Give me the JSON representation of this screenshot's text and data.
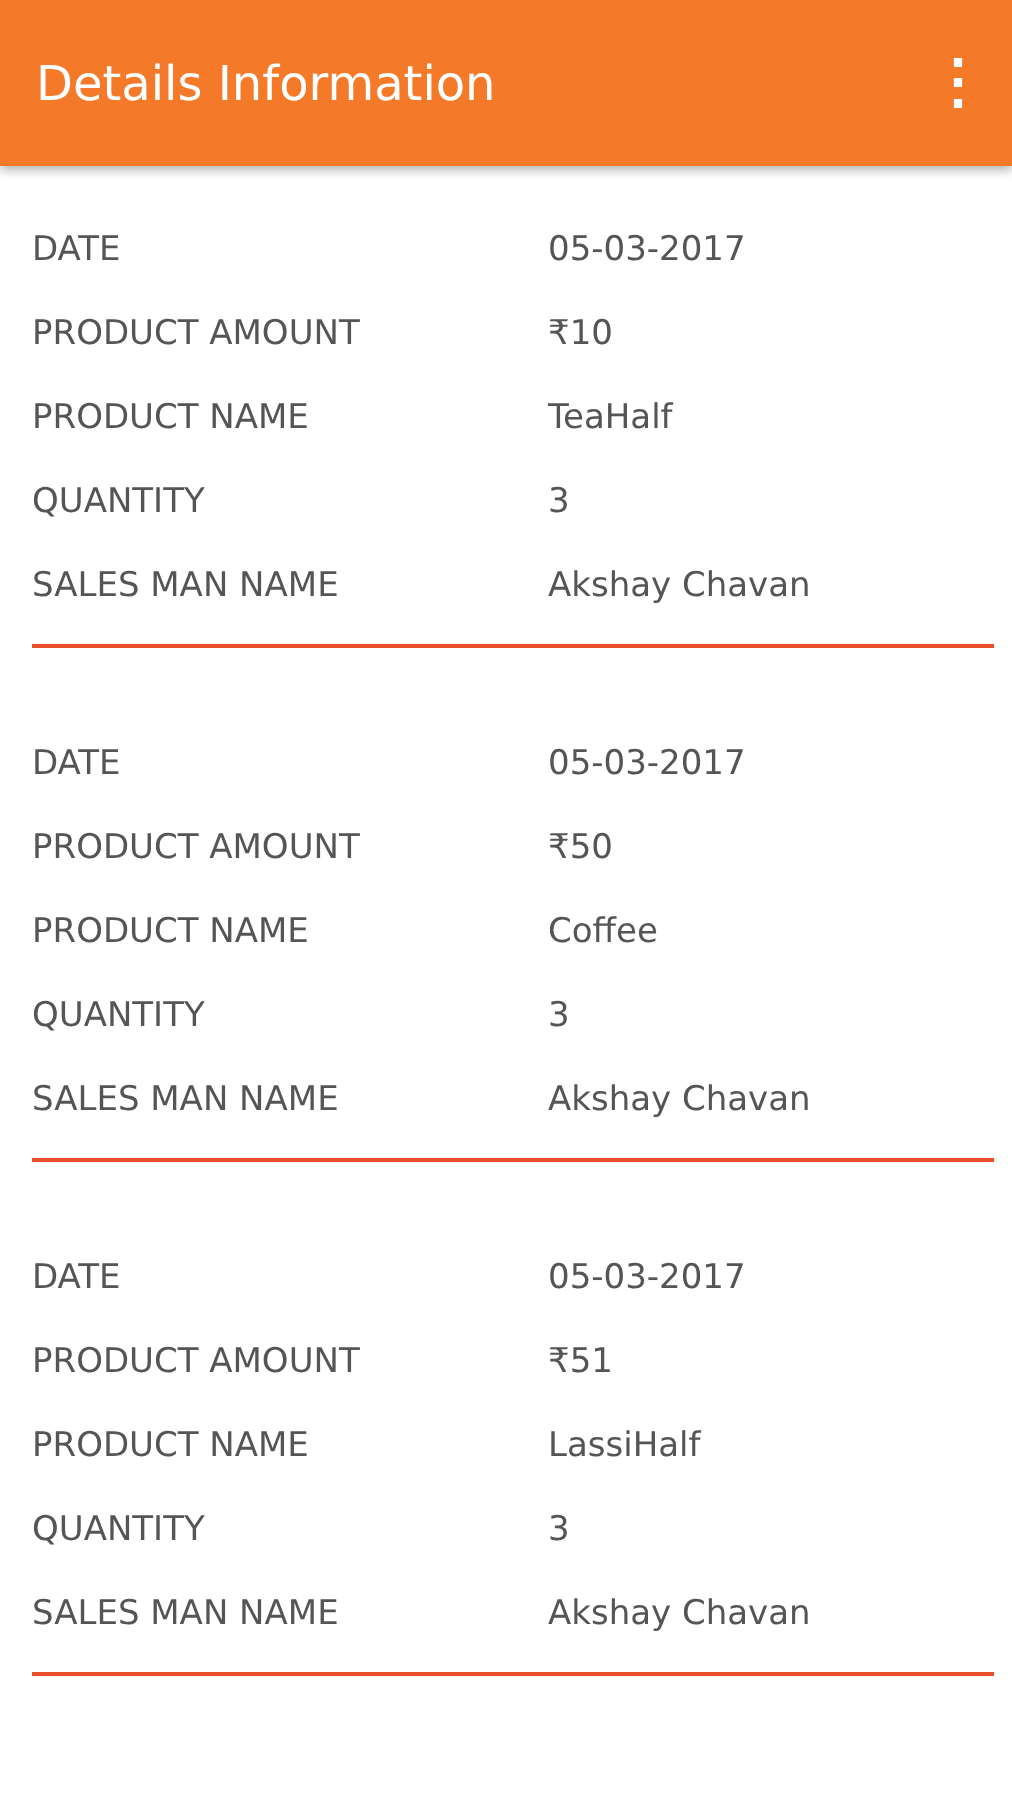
{
  "app_bar": {
    "title": "Details Information",
    "menu_icon": "⋮"
  },
  "records": [
    {
      "fields": [
        {
          "label": "DATE",
          "value": "05-03-2017"
        },
        {
          "label": "PRODUCT AMOUNT",
          "value": "₹10"
        },
        {
          "label": "PRODUCT NAME",
          "value": "TeaHalf"
        },
        {
          "label": "QUANTITY",
          "value": "3"
        },
        {
          "label": "SALES MAN NAME",
          "value": "Akshay Chavan"
        }
      ]
    },
    {
      "fields": [
        {
          "label": "DATE",
          "value": "05-03-2017"
        },
        {
          "label": "PRODUCT AMOUNT",
          "value": "₹50"
        },
        {
          "label": "PRODUCT NAME",
          "value": "Coffee"
        },
        {
          "label": "QUANTITY",
          "value": "3"
        },
        {
          "label": "SALES MAN NAME",
          "value": "Akshay Chavan"
        }
      ]
    },
    {
      "fields": [
        {
          "label": "DATE",
          "value": "05-03-2017"
        },
        {
          "label": "PRODUCT AMOUNT",
          "value": "₹51"
        },
        {
          "label": "PRODUCT NAME",
          "value": "LassiHalf"
        },
        {
          "label": "QUANTITY",
          "value": "3"
        },
        {
          "label": "SALES MAN NAME",
          "value": "Akshay Chavan"
        }
      ]
    }
  ]
}
